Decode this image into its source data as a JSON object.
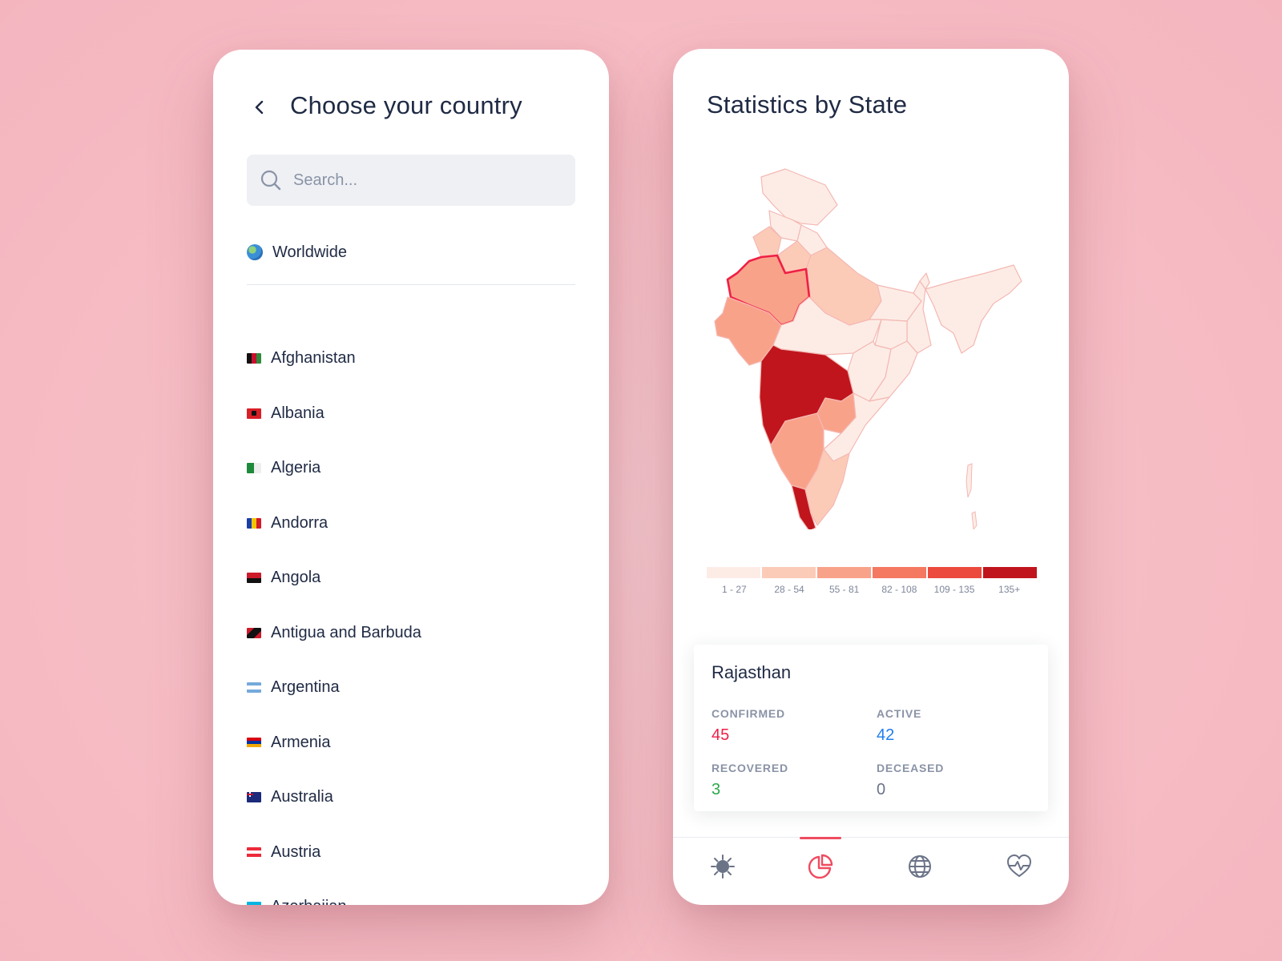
{
  "left_screen": {
    "title": "Choose your country",
    "search": {
      "placeholder": "Search..."
    },
    "worldwide": "Worldwide",
    "countries": [
      "Afghanistan",
      "Albania",
      "Algeria",
      "Andorra",
      "Angola",
      "Antigua and Barbuda",
      "Argentina",
      "Armenia",
      "Australia",
      "Austria",
      "Azerbaijan"
    ]
  },
  "right_screen": {
    "title": "Statistics by State",
    "selected_state": "Rajasthan",
    "legend": {
      "ranges": [
        "1 - 27",
        "28 - 54",
        "55 - 81",
        "82 - 108",
        "109 - 135",
        "135+"
      ],
      "colors": [
        "#fdece6",
        "#fccbb8",
        "#f9a28a",
        "#f57860",
        "#ec4a3c",
        "#c0151d"
      ]
    },
    "stats": {
      "confirmed": {
        "label": "CONFIRMED",
        "value": "45",
        "color": "#ef1f45"
      },
      "active": {
        "label": "ACTIVE",
        "value": "42",
        "color": "#1f7ef0"
      },
      "recovered": {
        "label": "RECOVERED",
        "value": "3",
        "color": "#2aa84a"
      },
      "deceased": {
        "label": "DECEASED",
        "value": "0",
        "color": "#6b7387"
      }
    },
    "tabs": [
      "virus-icon",
      "pie-chart-icon",
      "globe-icon",
      "heart-pulse-icon"
    ],
    "active_tab": "pie-chart-icon",
    "accent_color": "#ef4b60",
    "highlight_color": "#ef1f45"
  }
}
